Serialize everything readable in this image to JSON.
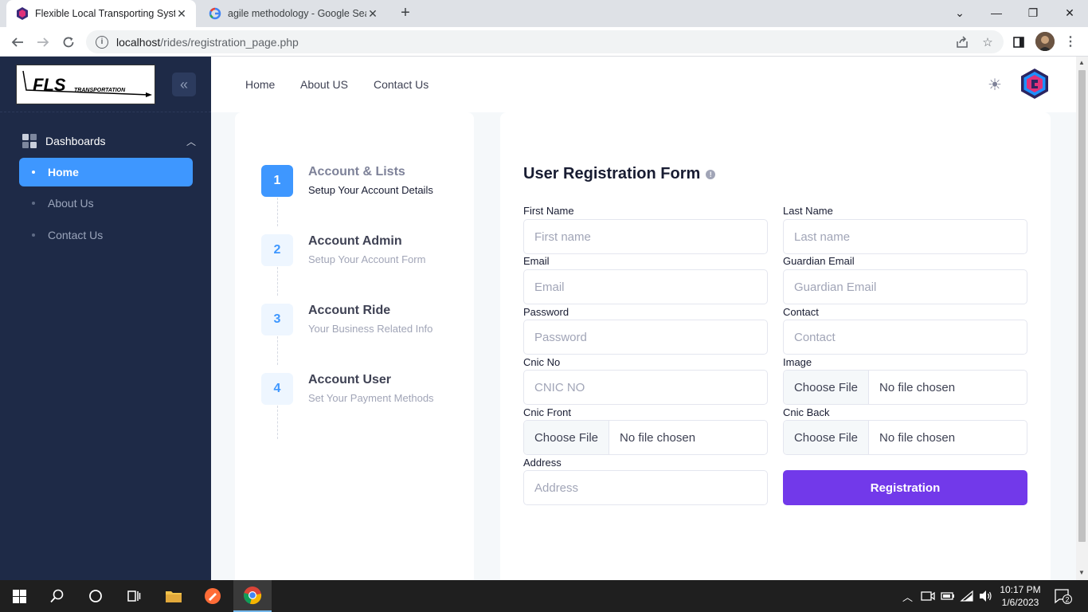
{
  "browser": {
    "tabs": [
      {
        "title": "Flexible Local Transporting System",
        "active": true
      },
      {
        "title": "agile methodology - Google Search",
        "active": false
      }
    ],
    "url_host": "localhost",
    "url_path": "/rides/registration_page.php"
  },
  "sidebar": {
    "logo_text": "FLS",
    "logo_subtext": "TRANSPORTATION",
    "menu_heading": "Dashboards",
    "items": [
      {
        "label": "Home",
        "active": true
      },
      {
        "label": "About Us",
        "active": false
      },
      {
        "label": "Contact Us",
        "active": false
      }
    ]
  },
  "header": {
    "nav": [
      "Home",
      "About US",
      "Contact Us"
    ]
  },
  "stepper": {
    "steps": [
      {
        "number": "1",
        "title": "Account & Lists",
        "description": "Setup Your Account Details",
        "current": true
      },
      {
        "number": "2",
        "title": "Account Admin",
        "description": "Setup Your Account Form",
        "current": false
      },
      {
        "number": "3",
        "title": "Account Ride",
        "description": "Your Business Related Info",
        "current": false
      },
      {
        "number": "4",
        "title": "Account User",
        "description": "Set Your Payment Methods",
        "current": false
      }
    ]
  },
  "form": {
    "title": "User Registration Form",
    "first_name": {
      "label": "First Name",
      "placeholder": "First name"
    },
    "last_name": {
      "label": "Last Name",
      "placeholder": "Last name"
    },
    "email": {
      "label": "Email",
      "placeholder": "Email"
    },
    "guardian_email": {
      "label": "Guardian Email",
      "placeholder": "Guardian Email"
    },
    "password": {
      "label": "Password",
      "placeholder": "Password"
    },
    "contact": {
      "label": "Contact",
      "placeholder": "Contact"
    },
    "cnic_no": {
      "label": "Cnic No",
      "placeholder": "CNIC NO"
    },
    "image": {
      "label": "Image",
      "button": "Choose File",
      "status": "No file chosen"
    },
    "cnic_front": {
      "label": "Cnic Front",
      "button": "Choose File",
      "status": "No file chosen"
    },
    "cnic_back": {
      "label": "Cnic Back",
      "button": "Choose File",
      "status": "No file chosen"
    },
    "address": {
      "label": "Address",
      "placeholder": "Address"
    },
    "submit_label": "Registration"
  },
  "taskbar": {
    "time": "10:17 PM",
    "date": "1/6/2023",
    "notification_count": "2"
  },
  "colors": {
    "sidebar_bg": "#1e2a47",
    "primary": "#3e97ff",
    "submit": "#7239ea"
  }
}
